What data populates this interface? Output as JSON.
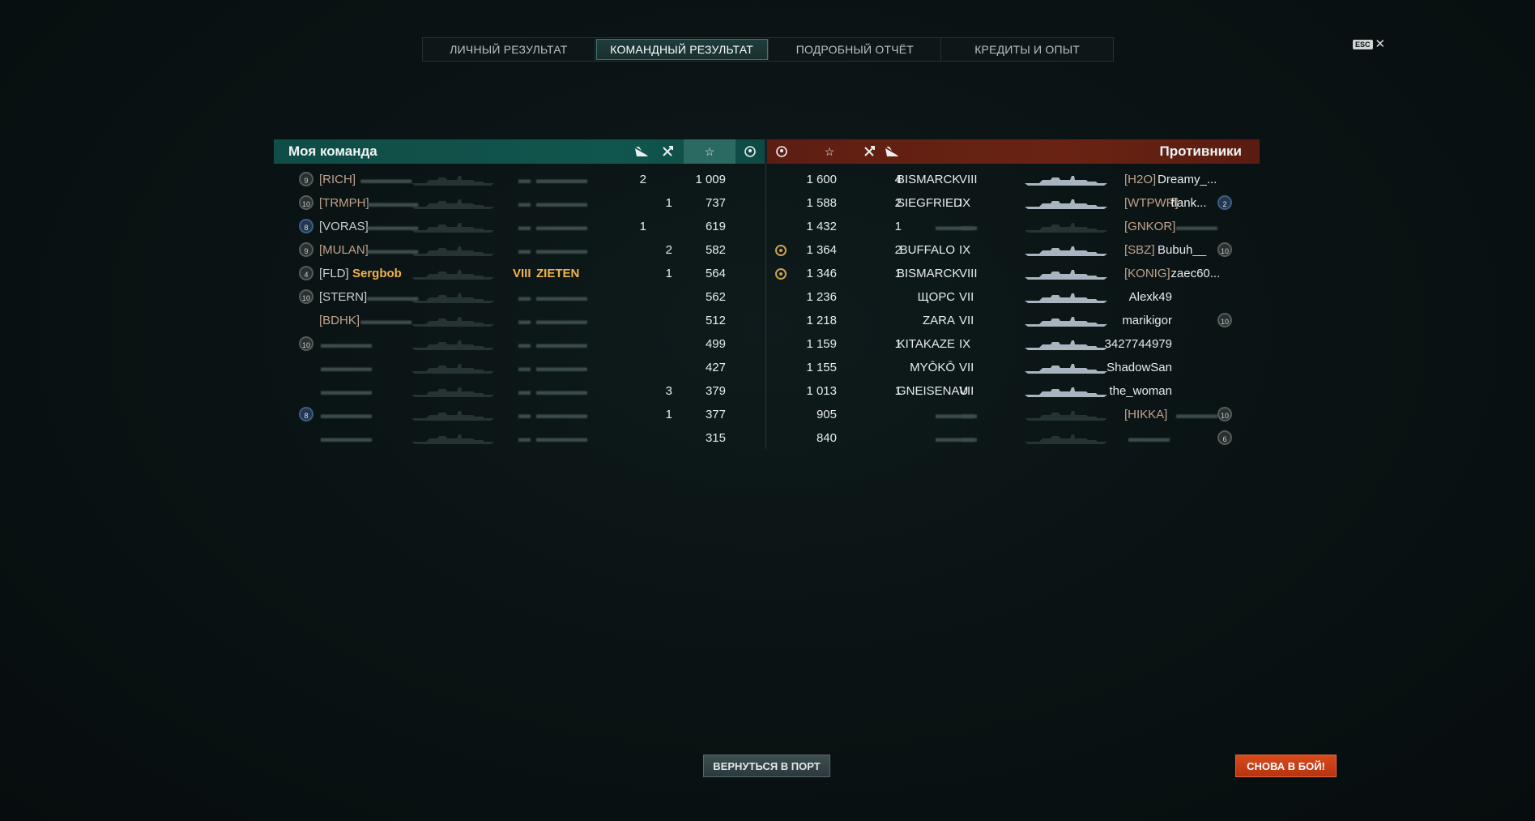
{
  "tabs": [
    {
      "label": "ЛИЧНЫЙ РЕЗУЛЬТАТ",
      "active": false
    },
    {
      "label": "КОМАНДНЫЙ РЕЗУЛЬТАТ",
      "active": true
    },
    {
      "label": "ПОДРОБНЫЙ ОТЧЁТ",
      "active": false
    },
    {
      "label": "КРЕДИТЫ И ОПЫТ",
      "active": false
    }
  ],
  "esc": {
    "badge": "ESC",
    "close": "✕"
  },
  "my_team": {
    "title": "Моя команда",
    "header_icons": [
      "plane-icon",
      "crossed-swords-icon",
      "star-icon",
      "laurel-icon"
    ],
    "colors": {
      "header": "#10564e",
      "highlight": "#f0b24b",
      "clan": "#c0a38c"
    },
    "players": [
      {
        "level": "9",
        "level_style": "grey",
        "clan": "[RICH]",
        "clan_white": false,
        "name": "",
        "tier": "",
        "ship": "",
        "planes": "2",
        "kills": "",
        "xp": "1 009",
        "highlight": false
      },
      {
        "level": "10",
        "level_style": "grey",
        "clan": "[TRMPH]",
        "clan_white": false,
        "name": "",
        "tier": "",
        "ship": "",
        "planes": "",
        "kills": "1",
        "xp": "737",
        "highlight": false
      },
      {
        "level": "8",
        "level_style": "blue",
        "clan": "[VORAS]",
        "clan_white": true,
        "name": "",
        "tier": "",
        "ship": "",
        "planes": "1",
        "kills": "",
        "xp": "619",
        "highlight": false
      },
      {
        "level": "9",
        "level_style": "grey",
        "clan": "[MULAN]",
        "clan_white": false,
        "name": "",
        "tier": "",
        "ship": "",
        "planes": "",
        "kills": "2",
        "xp": "582",
        "highlight": false
      },
      {
        "level": "4",
        "level_style": "grey",
        "clan": "[FLD]",
        "clan_white": true,
        "name": "Sergbob",
        "tier": "VIII",
        "ship": "ZIETEN",
        "planes": "",
        "kills": "1",
        "xp": "564",
        "highlight": true
      },
      {
        "level": "10",
        "level_style": "grey",
        "clan": "[STERN]",
        "clan_white": true,
        "name": "",
        "tier": "",
        "ship": "",
        "planes": "",
        "kills": "",
        "xp": "562",
        "highlight": false
      },
      {
        "level": "",
        "level_style": "none",
        "clan": "[BDHK]",
        "clan_white": false,
        "name": "",
        "tier": "",
        "ship": "",
        "planes": "",
        "kills": "",
        "xp": "512",
        "highlight": false
      },
      {
        "level": "10",
        "level_style": "grey",
        "clan": "",
        "clan_white": false,
        "name": "",
        "tier": "",
        "ship": "",
        "planes": "",
        "kills": "",
        "xp": "499",
        "highlight": false
      },
      {
        "level": "",
        "level_style": "none",
        "clan": "",
        "clan_white": false,
        "name": "",
        "tier": "",
        "ship": "",
        "planes": "",
        "kills": "",
        "xp": "427",
        "highlight": false
      },
      {
        "level": "",
        "level_style": "none",
        "clan": "",
        "clan_white": false,
        "name": "",
        "tier": "",
        "ship": "",
        "planes": "",
        "kills": "3",
        "xp": "379",
        "highlight": false
      },
      {
        "level": "8",
        "level_style": "blue",
        "clan": "",
        "clan_white": false,
        "name": "",
        "tier": "",
        "ship": "",
        "planes": "",
        "kills": "1",
        "xp": "377",
        "highlight": false
      },
      {
        "level": "",
        "level_style": "none",
        "clan": "",
        "clan_white": false,
        "name": "",
        "tier": "",
        "ship": "",
        "planes": "",
        "kills": "",
        "xp": "315",
        "highlight": false
      }
    ]
  },
  "enemy_team": {
    "title": "Противники",
    "header_icons": [
      "laurel-icon",
      "star-icon",
      "crossed-swords-icon",
      "plane-icon"
    ],
    "colors": {
      "header": "#6a2313",
      "clan": "#c0a38c"
    },
    "players": [
      {
        "medal": false,
        "xp": "1 600",
        "kills": "4",
        "ship": "BISMARCK",
        "tier": "VIII",
        "clan": "[H2O]",
        "name": "Dreamy_...",
        "level": "",
        "level_style": "none",
        "blurred": false
      },
      {
        "medal": false,
        "xp": "1 588",
        "kills": "2",
        "ship": "SIEGFRIED",
        "tier": "IX",
        "clan": "[WTPWR]",
        "name": "flank...",
        "level": "2",
        "level_style": "blue",
        "blurred": false
      },
      {
        "medal": false,
        "xp": "1 432",
        "kills": "1",
        "ship": "",
        "tier": "",
        "clan": "[GNKOR]",
        "name": "",
        "level": "",
        "level_style": "none",
        "blurred": true
      },
      {
        "medal": true,
        "xp": "1 364",
        "kills": "2",
        "ship": "BUFFALO",
        "tier": "IX",
        "clan": "[SBZ]",
        "name": "Bubuh__",
        "level": "10",
        "level_style": "grey",
        "blurred": false
      },
      {
        "medal": true,
        "xp": "1 346",
        "kills": "1",
        "ship": "BISMARCK",
        "tier": "VIII",
        "clan": "[KONIG]",
        "name": "zaec60...",
        "level": "",
        "level_style": "none",
        "blurred": false
      },
      {
        "medal": false,
        "xp": "1 236",
        "kills": "",
        "ship": "ЩОРС",
        "tier": "VII",
        "clan": "",
        "name": "Alexk49",
        "level": "",
        "level_style": "none",
        "blurred": false
      },
      {
        "medal": false,
        "xp": "1 218",
        "kills": "",
        "ship": "ZARA",
        "tier": "VII",
        "clan": "",
        "name": "marikigor",
        "level": "10",
        "level_style": "grey",
        "blurred": false
      },
      {
        "medal": false,
        "xp": "1 159",
        "kills": "1",
        "ship": "KITAKAZE",
        "tier": "IX",
        "clan": "",
        "name": "3427744979",
        "level": "",
        "level_style": "none",
        "blurred": false
      },
      {
        "medal": false,
        "xp": "1 155",
        "kills": "",
        "ship": "MYŌKŌ",
        "tier": "VII",
        "clan": "",
        "name": "ShadowSan",
        "level": "",
        "level_style": "none",
        "blurred": false
      },
      {
        "medal": false,
        "xp": "1 013",
        "kills": "1",
        "ship": "GNEISENAU",
        "tier": "VII",
        "clan": "",
        "name": "the_woman",
        "level": "",
        "level_style": "none",
        "blurred": false
      },
      {
        "medal": false,
        "xp": "905",
        "kills": "",
        "ship": "",
        "tier": "",
        "clan": "[HIKKA]",
        "name": "",
        "level": "10",
        "level_style": "grey",
        "blurred": true
      },
      {
        "medal": false,
        "xp": "840",
        "kills": "",
        "ship": "",
        "tier": "",
        "clan": "",
        "name": "",
        "level": "6",
        "level_style": "grey",
        "blurred": true
      }
    ]
  },
  "buttons": {
    "port": "ВЕРНУТЬСЯ В ПОРТ",
    "battle": "СНОВА В БОЙ!"
  }
}
